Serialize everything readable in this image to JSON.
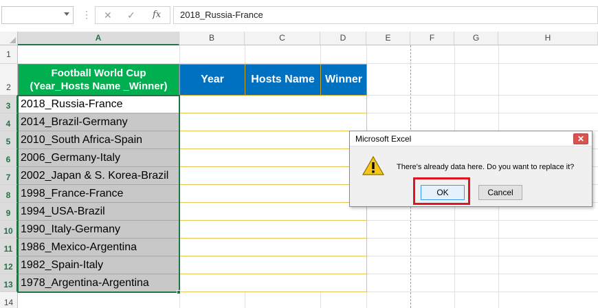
{
  "formula_bar": {
    "name_box": "",
    "cancel_icon": "x-icon",
    "enter_icon": "check-icon",
    "function_label": "fx",
    "formula_value": "2018_Russia-France"
  },
  "columns": [
    "A",
    "B",
    "C",
    "D",
    "E",
    "F",
    "G",
    "H"
  ],
  "rows": [
    "1",
    "2",
    "3",
    "4",
    "5",
    "6",
    "7",
    "8",
    "9",
    "10",
    "11",
    "12",
    "13",
    "14"
  ],
  "table": {
    "header_a": "Football World Cup\n(Year_Hosts Name _Winner)",
    "header_a_line1": "Football World Cup",
    "header_a_line2": "(Year_Hosts Name _Winner)",
    "header_b": "Year",
    "header_c": "Hosts Name",
    "header_d": "Winner",
    "data": [
      "2018_Russia-France",
      "2014_Brazil-Germany",
      "2010_South Africa-Spain",
      "2006_Germany-Italy",
      "2002_Japan & S. Korea-Brazil",
      "1998_France-France",
      "1994_USA-Brazil",
      "1990_Italy-Germany",
      "1986_Mexico-Argentina",
      "1982_Spain-Italy",
      "1978_Argentina-Argentina"
    ]
  },
  "colors": {
    "header_green": "#00b050",
    "header_blue": "#0070c0",
    "selection": "#217346",
    "highlight_red": "#e0141e"
  },
  "dialog": {
    "title": "Microsoft Excel",
    "message": "There's already data here. Do you want to replace it?",
    "ok_label": "OK",
    "cancel_label": "Cancel",
    "close_label": "✕",
    "icon": "warning-icon"
  }
}
